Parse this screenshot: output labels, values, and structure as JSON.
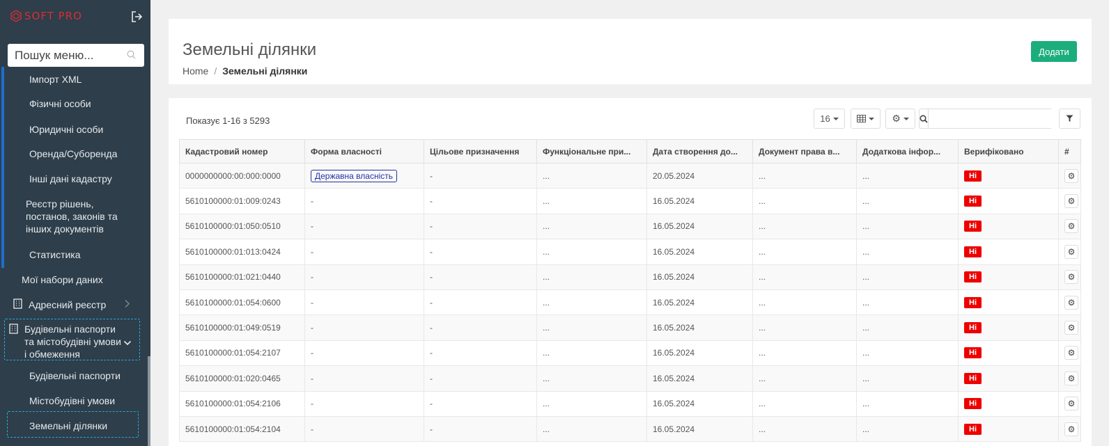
{
  "app": {
    "logo_text": "SOFT PRO"
  },
  "sidebar": {
    "search_placeholder": "Пошук меню...",
    "items": [
      {
        "label": "Імпорт XML"
      },
      {
        "label": "Фізичні особи"
      },
      {
        "label": "Юридичні особи"
      },
      {
        "label": "Оренда/Суборенда"
      },
      {
        "label": "Інші дані кадастру"
      },
      {
        "label": "Реєстр рішень, постанов, законів та інших документів"
      },
      {
        "label": "Статистика"
      },
      {
        "label": "Мої набори даних"
      },
      {
        "label": "Адресний реєстр"
      },
      {
        "label": "Будівельні паспорти та містобудівні умови і обмеження"
      },
      {
        "label": "Будівельні паспорти"
      },
      {
        "label": "Містобудівні умови"
      },
      {
        "label": "Земельні ділянки"
      }
    ]
  },
  "header": {
    "title": "Земельні ділянки",
    "breadcrumb": {
      "home": "Home",
      "separator": "/",
      "current": "Земельні ділянки"
    },
    "add_label": "Додати",
    "add_color": "#1cad7d"
  },
  "toolbar": {
    "summary": "Показує 1-16 з 5293",
    "page_size": "16",
    "search_value": ""
  },
  "table": {
    "columns": [
      "Кадастровий номер",
      "Форма власності",
      "Цільове призначення",
      "Функціональне при...",
      "Дата створення до...",
      "Документ права в...",
      "Додаткова інфор...",
      "Верифіковано",
      "#"
    ],
    "rows": [
      {
        "cad": "0000000000:00:000:0000",
        "ownership": "Державна власність",
        "purpose": "-",
        "func": "...",
        "date": "20.05.2024",
        "doc": "...",
        "extra": "...",
        "verified": "Ні"
      },
      {
        "cad": "5610100000:01:009:0243",
        "ownership": "-",
        "purpose": "-",
        "func": "...",
        "date": "16.05.2024",
        "doc": "...",
        "extra": "...",
        "verified": "Ні"
      },
      {
        "cad": "5610100000:01:050:0510",
        "ownership": "-",
        "purpose": "-",
        "func": "...",
        "date": "16.05.2024",
        "doc": "...",
        "extra": "...",
        "verified": "Ні"
      },
      {
        "cad": "5610100000:01:013:0424",
        "ownership": "-",
        "purpose": "-",
        "func": "...",
        "date": "16.05.2024",
        "doc": "...",
        "extra": "...",
        "verified": "Ні"
      },
      {
        "cad": "5610100000:01:021:0440",
        "ownership": "-",
        "purpose": "-",
        "func": "...",
        "date": "16.05.2024",
        "doc": "...",
        "extra": "...",
        "verified": "Ні"
      },
      {
        "cad": "5610100000:01:054:0600",
        "ownership": "-",
        "purpose": "-",
        "func": "...",
        "date": "16.05.2024",
        "doc": "...",
        "extra": "...",
        "verified": "Ні"
      },
      {
        "cad": "5610100000:01:049:0519",
        "ownership": "-",
        "purpose": "-",
        "func": "...",
        "date": "16.05.2024",
        "doc": "...",
        "extra": "...",
        "verified": "Ні"
      },
      {
        "cad": "5610100000:01:054:2107",
        "ownership": "-",
        "purpose": "-",
        "func": "...",
        "date": "16.05.2024",
        "doc": "...",
        "extra": "...",
        "verified": "Ні"
      },
      {
        "cad": "5610100000:01:020:0465",
        "ownership": "-",
        "purpose": "-",
        "func": "...",
        "date": "16.05.2024",
        "doc": "...",
        "extra": "...",
        "verified": "Ні"
      },
      {
        "cad": "5610100000:01:054:2106",
        "ownership": "-",
        "purpose": "-",
        "func": "...",
        "date": "16.05.2024",
        "doc": "...",
        "extra": "...",
        "verified": "Ні"
      },
      {
        "cad": "5610100000:01:054:2104",
        "ownership": "-",
        "purpose": "-",
        "func": "...",
        "date": "16.05.2024",
        "doc": "...",
        "extra": "...",
        "verified": "Ні"
      }
    ]
  },
  "colors": {
    "sidebar_bg": "#2e3e4a",
    "accent": "#1d6fcf",
    "badge_no": "#ee0000",
    "brand": "#d92d35"
  }
}
